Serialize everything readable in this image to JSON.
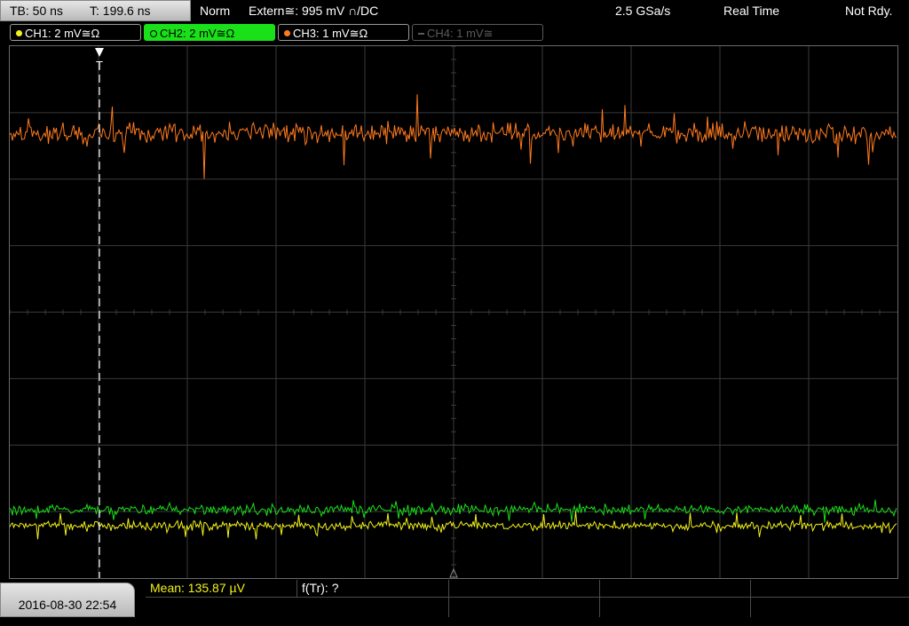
{
  "timebase": {
    "tb": "TB: 50 ns",
    "trigger_time": "T: 199.6 ns"
  },
  "status": {
    "mode": "Norm",
    "trigger": "Extern≅: 995 mV ∩/DC",
    "sample_rate": "2.5 GSa/s",
    "acquisition": "Real Time",
    "state": "Not Rdy."
  },
  "channels": [
    {
      "label": "CH1: 2 mV≅Ω",
      "color": "#f2f21a",
      "state": "on"
    },
    {
      "label": "CH2: 2 mV≅Ω",
      "color": "#19e019",
      "state": "selected"
    },
    {
      "label": "CH3: 1 mV≅Ω",
      "color": "#ff7a1e",
      "state": "on"
    },
    {
      "label": "CH4: 1 mV≅",
      "color": "#5a5a5a",
      "state": "off"
    }
  ],
  "trigger_marker": "T",
  "waveform_colors": {
    "ch1": "#f2f21a",
    "ch2": "#19e019",
    "ch3": "#ff7a1e",
    "grid": "#3a3a3a"
  },
  "date_time": "2016-08-30 22:54",
  "measurements": {
    "mean": "Mean: 135.87 µV",
    "freq": "f(Tr): ?"
  }
}
